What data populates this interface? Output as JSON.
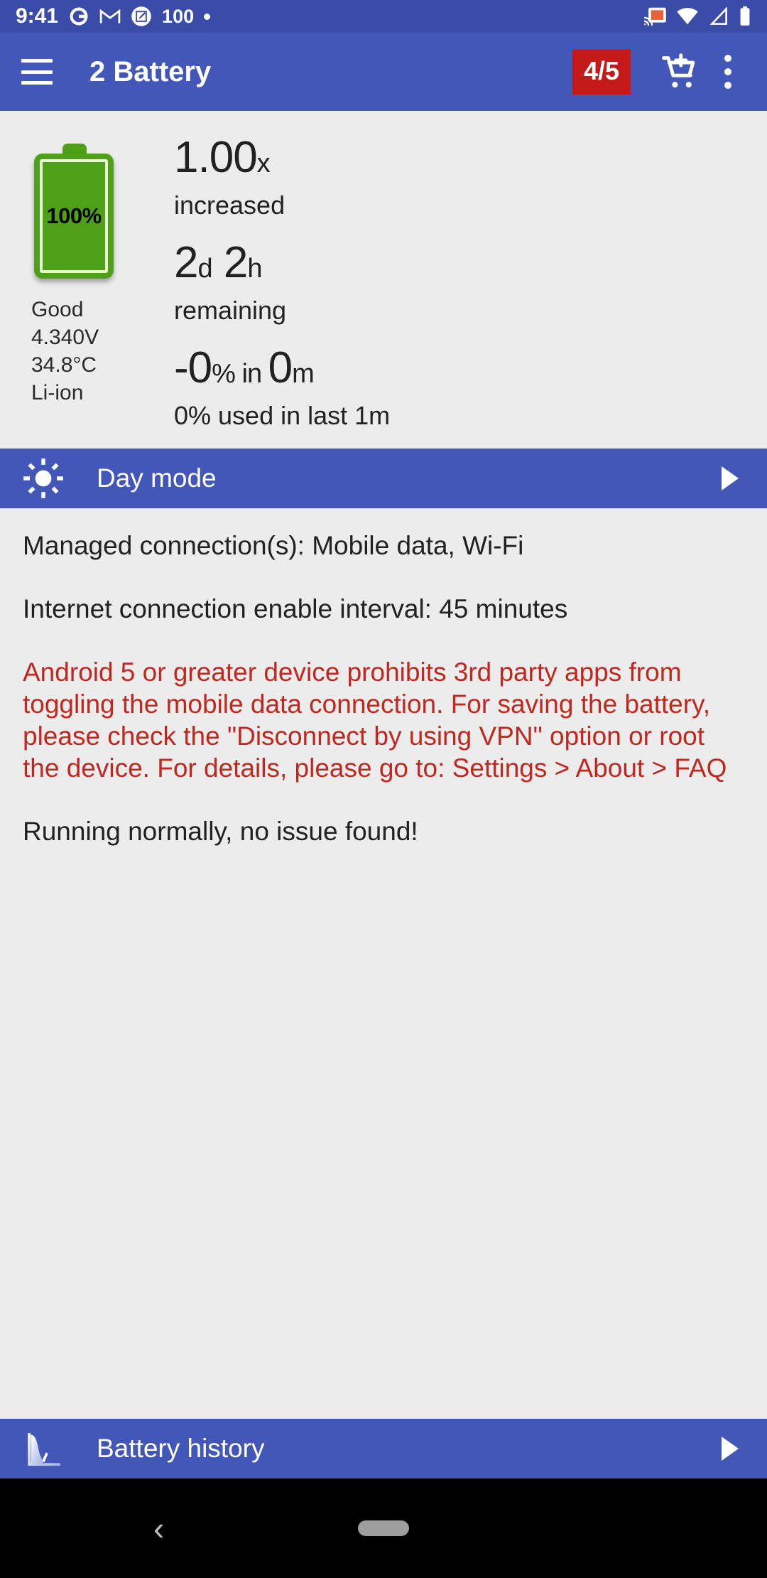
{
  "status_bar": {
    "time": "9:41",
    "battery_number": "100",
    "icons_left": [
      "google-icon",
      "gmail-icon",
      "screenshot-edit-icon",
      "dot-indicator"
    ],
    "icons_right": [
      "cast-icon",
      "wifi-icon",
      "cellular-signal-icon",
      "battery-full-icon"
    ],
    "bg_color": "#3b4ba8"
  },
  "app_bar": {
    "title": "2 Battery",
    "badge": "4/5",
    "badge_color": "#c61a1a",
    "bg_color": "#4257b7",
    "menu_icon": "hamburger-menu-icon",
    "cart_icon": "add-to-cart-icon",
    "overflow_icon": "overflow-menu-icon"
  },
  "summary": {
    "battery_level_label": "100%",
    "battery_color": "#4da017",
    "health": "Good",
    "voltage": "4.340V",
    "temperature": "34.8°C",
    "technology": "Li-ion",
    "stats": [
      {
        "value": "1.00",
        "unit": "x",
        "caption": "increased"
      },
      {
        "value": "2",
        "unit": "d",
        "value2": "2",
        "unit2": "h",
        "caption": "remaining"
      },
      {
        "value": "-0",
        "unit": "%",
        "mid": " in ",
        "value2": "0",
        "unit2": "m",
        "caption": "0% used in last 1m"
      }
    ]
  },
  "rows": [
    {
      "label": "Day mode",
      "icon": "sun-icon",
      "arrow": "play-arrow-icon"
    },
    {
      "label": "Battery history",
      "icon": "line-chart-icon",
      "arrow": "play-arrow-icon"
    }
  ],
  "info": {
    "paragraphs": [
      {
        "text": "Managed connection(s): Mobile data, Wi-Fi",
        "style": "normal"
      },
      {
        "text": "Internet connection enable interval: 45 minutes",
        "style": "normal"
      },
      {
        "text": "Android 5 or greater device prohibits 3rd party apps from toggling the mobile data connection. For saving the battery, please check the \"Disconnect by using VPN\" option or root the device. For details, please go to: Settings > About > FAQ",
        "style": "warning"
      },
      {
        "text": "Running normally, no issue found!",
        "style": "normal"
      }
    ],
    "warning_color": "#c0281f"
  },
  "nav_bar": {
    "back_icon": "back-chevron-icon",
    "home_icon": "home-pill-icon",
    "bg_color": "#000000"
  }
}
